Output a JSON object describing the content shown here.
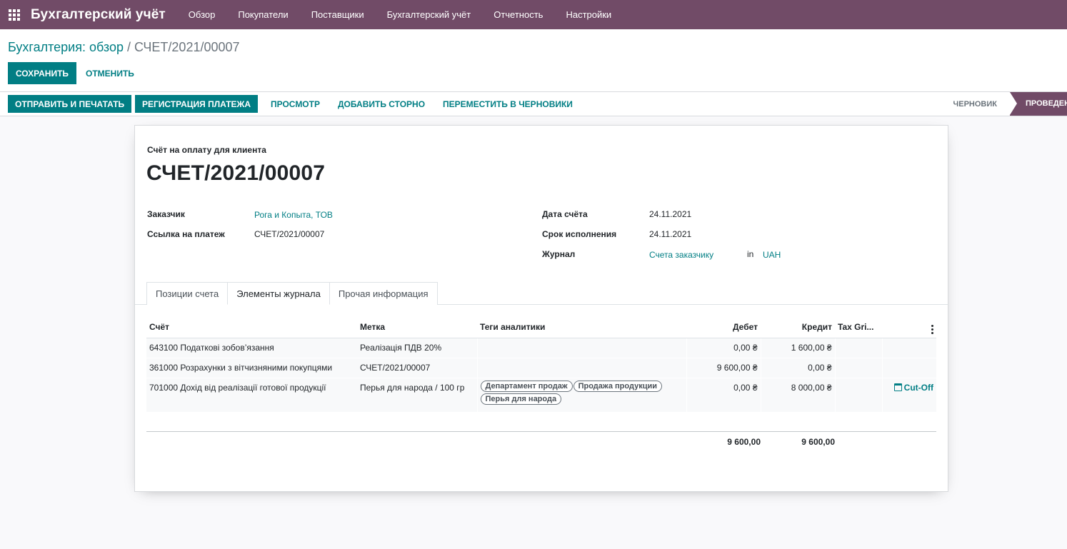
{
  "navbar": {
    "brand": "Бухгалтерский учёт",
    "items": [
      "Обзор",
      "Покупатели",
      "Поставщики",
      "Бухгалтерский учёт",
      "Отчетность",
      "Настройки"
    ]
  },
  "breadcrumb": {
    "parent": "Бухгалтерия: обзор",
    "separator": "/",
    "current": "СЧЕТ/2021/00007"
  },
  "actions": {
    "save": "СОХРАНИТЬ",
    "cancel": "ОТМЕНИТЬ"
  },
  "statusbar": {
    "send_print": "ОТПРАВИТЬ И ПЕЧАТАТЬ",
    "register_payment": "РЕГИСТРАЦИЯ ПЛАТЕЖА",
    "preview": "ПРОСМОТР",
    "add_reversal": "ДОБАВИТЬ СТОРНО",
    "reset_draft": "ПЕРЕМЕСТИТЬ В ЧЕРНОВИКИ",
    "states": [
      "ЧЕРНОВИК",
      "ПРОВЕДЕН"
    ]
  },
  "invoice": {
    "type": "Счёт на оплату для клиента",
    "name": "СЧЕТ/2021/00007",
    "customer_label": "Заказчик",
    "customer": "Рога и Копыта, ТОВ",
    "payment_ref_label": "Ссылка на платеж",
    "payment_ref": "СЧЕТ/2021/00007",
    "date_label": "Дата счёта",
    "date": "24.11.2021",
    "due_label": "Срок исполнения",
    "due": "24.11.2021",
    "journal_label": "Журнал",
    "journal": "Счета заказчику",
    "in_label": "in",
    "currency": "UAH"
  },
  "tabs": [
    "Позиции счета",
    "Элементы журнала",
    "Прочая информация"
  ],
  "journal_table": {
    "headers": [
      "Счёт",
      "Метка",
      "Теги аналитики",
      "Дебет",
      "Кредит",
      "Tax Gri..."
    ],
    "rows": [
      {
        "account": "643100 Податкові зобов’язання",
        "label": "Реалізація ПДВ 20%",
        "tags": [],
        "debit": "0,00 ₴",
        "credit": "1 600,00 ₴",
        "extra": ""
      },
      {
        "account": "361000 Розрахунки з вітчизняними покупцями",
        "label": "СЧЕТ/2021/00007",
        "tags": [],
        "debit": "9 600,00 ₴",
        "credit": "0,00 ₴",
        "extra": ""
      },
      {
        "account": "701000 Дохід від реалізації готової продукції",
        "label": "Перья для народа / 100 гр",
        "tags": [
          "Департамент продаж",
          "Продажа продукции",
          "Перья для народа"
        ],
        "debit": "0,00 ₴",
        "credit": "8 000,00 ₴",
        "extra": "Cut-Off"
      }
    ],
    "total_debit": "9 600,00",
    "total_credit": "9 600,00"
  }
}
